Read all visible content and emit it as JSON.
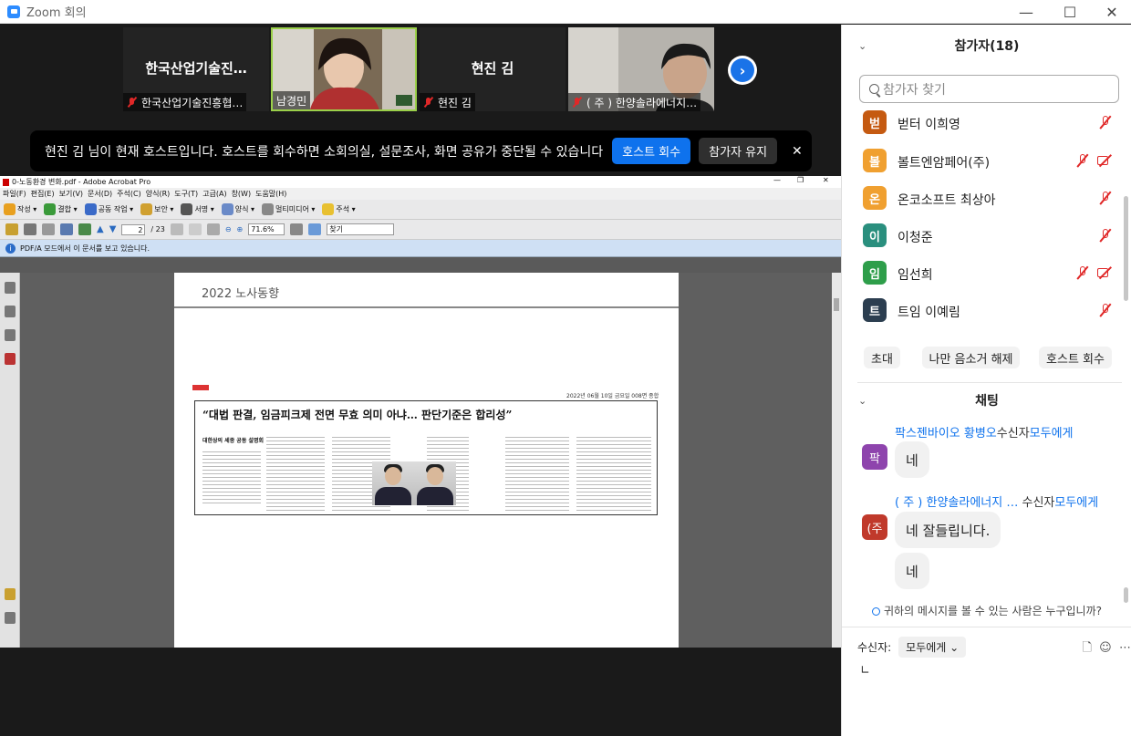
{
  "window": {
    "title": "Zoom 회의"
  },
  "video_tiles": [
    {
      "name_display": "한국산업기술진…",
      "label": "한국산업기술진흥협…",
      "has_video": false
    },
    {
      "name_display": "",
      "label": "남경민",
      "has_video": true
    },
    {
      "name_display": "현진 김",
      "label": "현진 김",
      "has_video": false
    },
    {
      "name_display": "",
      "label": "( 주 ) 한양솔라에너지…",
      "has_video": true
    }
  ],
  "host_banner": {
    "message": "현진 김 님이 현재 호스트입니다. 호스트를 회수하면 소회의실, 설문조사, 화면 공유가 중단될 수 있습니다",
    "reclaim_label": "호스트 회수",
    "stay_label": "참가자 유지",
    "close_glyph": "✕"
  },
  "acrobat": {
    "title": "0-노동환경 변화.pdf - Adobe Acrobat Pro",
    "menu": [
      "파일(F)",
      "편집(E)",
      "보기(V)",
      "문서(D)",
      "주석(C)",
      "양식(R)",
      "도구(T)",
      "고급(A)",
      "창(W)",
      "도움말(H)"
    ],
    "toolbar": [
      "작성",
      "결합",
      "공동 작업",
      "보안",
      "서명",
      "양식",
      "멀티미디어",
      "주석"
    ],
    "page_current": "2",
    "page_total": "/ 23",
    "zoom": "71.6%",
    "find_placeholder": "찾기",
    "info_bar": "PDF/A 모드에서 이 문서를 보고 있습니다.",
    "doc": {
      "header": "2022 노사동향",
      "date_line": "2022년 06월 10일 금요일 008면 종합",
      "headline": "“대법 판결, 임금피크제 전면 무효 의미 아냐… 판단기준은 합리성”",
      "subhead": "대한상의 세종 공동 설명회"
    }
  },
  "participants": {
    "title": "참가자(18)",
    "search_placeholder": "참가자 찾기",
    "list": [
      {
        "initial": "벋",
        "name": "벋터 이희영",
        "color": "#c55a11",
        "mic_muted": true,
        "cam_off": false
      },
      {
        "initial": "볼",
        "name": "볼트엔암페어(주)",
        "color": "#f0a030",
        "mic_muted": true,
        "cam_off": true
      },
      {
        "initial": "온",
        "name": "온코소프트 최상아",
        "color": "#f0a030",
        "mic_muted": true,
        "cam_off": false
      },
      {
        "initial": "이",
        "name": "이청준",
        "color": "#2a8f7e",
        "mic_muted": true,
        "cam_off": false
      },
      {
        "initial": "임",
        "name": "임선희",
        "color": "#2e9e4a",
        "mic_muted": true,
        "cam_off": true
      },
      {
        "initial": "트",
        "name": "트임 이예림",
        "color": "#2c3e50",
        "mic_muted": true,
        "cam_off": false
      }
    ],
    "actions": [
      "초대",
      "나만 음소거 해제",
      "호스트 회수"
    ]
  },
  "chat": {
    "title": "채팅",
    "messages": [
      {
        "avatar": "팍",
        "avatar_color": "#8e44ad",
        "sender": "팍스젠바이오 황병오",
        "to_prefix": "수신자",
        "to": "모두에게",
        "texts": [
          "네"
        ]
      },
      {
        "avatar": "(주",
        "avatar_color": "#c0392b",
        "sender": "( 주 ) 한양솔라에너지 …",
        "to_prefix": "수신자",
        "to": "모두에게",
        "texts": [
          "네 잘들립니다.",
          "네"
        ]
      }
    ],
    "visibility_hint": "귀하의 메시지를 볼 수 있는 사람은 누구입니까?",
    "recipient_label": "수신자:",
    "recipient_value": "모두에게"
  }
}
